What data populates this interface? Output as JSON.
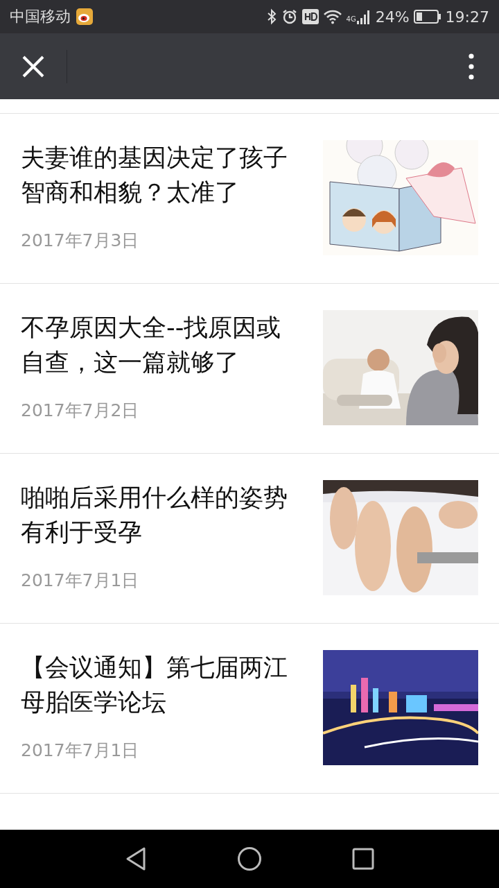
{
  "status_bar": {
    "carrier": "中国移动",
    "network": "4G",
    "battery": "24%",
    "time": "19:27"
  },
  "articles": [
    {
      "title": "夫妻谁的基因决定了孩子智商和相貌？太准了",
      "date": "2017年7月3日",
      "kind": "picture"
    },
    {
      "title": "不孕原因大全--找原因或自查，这一篇就够了",
      "date": "2017年7月2日",
      "kind": "picture"
    },
    {
      "title": "啪啪后采用什么样的姿势有利于受孕",
      "date": "2017年7月1日",
      "kind": "picture"
    },
    {
      "title": "【会议通知】第七届两江母胎医学论坛",
      "date": "2017年7月1日",
      "kind": "picture"
    }
  ]
}
